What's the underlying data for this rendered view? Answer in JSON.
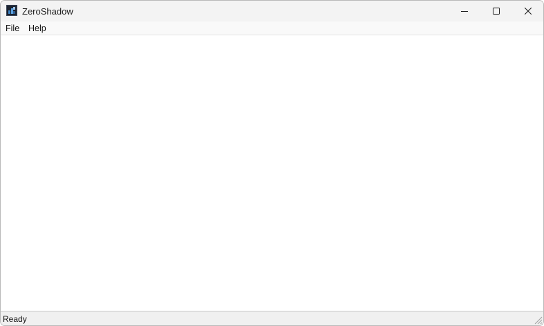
{
  "window": {
    "title": "ZeroShadow",
    "icon": "app-icon"
  },
  "caption_buttons": {
    "minimize_icon": "minimize-icon",
    "maximize_icon": "maximize-icon",
    "close_icon": "close-icon"
  },
  "menubar": {
    "items": [
      {
        "label": "File"
      },
      {
        "label": "Help"
      }
    ]
  },
  "statusbar": {
    "text": "Ready",
    "grip_icon": "resize-grip-icon"
  },
  "colors": {
    "titlebar_bg": "#f3f3f3",
    "menubar_bg": "#f9f9f9",
    "content_bg": "#ffffff",
    "statusbar_bg": "#f0f0f0"
  }
}
